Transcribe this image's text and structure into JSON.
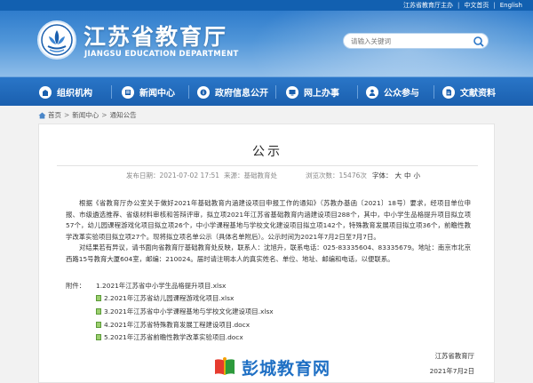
{
  "top_links": [
    "江苏省教育厅主办",
    "中文首页",
    "English"
  ],
  "header": {
    "title": "江苏省教育厅",
    "subtitle": "JIANGSU EDUCATION DEPARTMENT",
    "search_placeholder": "请输入关键词"
  },
  "nav": {
    "items": [
      {
        "label": "组织机构",
        "icon": "building-icon"
      },
      {
        "label": "新闻中心",
        "icon": "news-icon"
      },
      {
        "label": "政府信息公开",
        "icon": "info-open-icon"
      },
      {
        "label": "网上办事",
        "icon": "online-service-icon"
      },
      {
        "label": "公众参与",
        "icon": "public-participation-icon"
      },
      {
        "label": "文献资料",
        "icon": "documents-icon"
      }
    ]
  },
  "breadcrumb": [
    "首页",
    "新闻中心",
    "通知公告"
  ],
  "article": {
    "title": "公示",
    "date": "发布日期：2021-07-02 17:51",
    "source": "来源：基础教育处",
    "views": "浏览次数：15476次",
    "font_size_label": "字体：",
    "font_sizes": [
      "大",
      "中",
      "小"
    ],
    "paragraphs": [
      "根据《省教育厅办公室关于做好2021年基础教育内涵建设项目申报工作的通知》（苏教办基函〔2021〕18号）要求，经项目单位申报、市级遴选推荐、省级材料审核和答辩评审，拟立项2021年江苏省基础教育内涵建设项目288个，其中，中小学生品格提升项目拟立项57个，幼儿园课程游戏化项目拟立项26个，中小学课程基地与学校文化建设项目拟立项142个，特殊教育发展项目拟立项36个，前瞻性教学改革实验项目拟立项27个。现将拟立项名单公示（具体名单附后）。公示时间为2021年7月2日至7月7日。",
      "对结果若有异议，请书面向省教育厅基础教育处反映，联系人：沈旭升，联系电话：025-83335604、83335679。地址：南京市北京西路15号教育大厦604室，邮编：210024。届时请注明本人的真实姓名、单位、地址、邮编和电话，以便联系。"
    ],
    "attachments_label": "附件：",
    "attachments": [
      "1.2021年江苏省中小学生品格提升项目.xlsx",
      "2.2021年江苏省幼儿园课程游戏化项目.xlsx",
      "3.2021年江苏省中小学课程基地与学校文化建设项目.xlsx",
      "4.2021年江苏省特殊教育发展工程建设项目.docx",
      "5.2021年江苏省前瞻性教学改革实验项目.docx"
    ],
    "signature": "江苏省教育厅",
    "sign_date": "2021年7月2日"
  },
  "watermark": "彭城教育网",
  "colors": {
    "brand_blue": "#1a5fae",
    "header_blue": "#2f7ccc",
    "attachment_green": "#5a9a38"
  }
}
